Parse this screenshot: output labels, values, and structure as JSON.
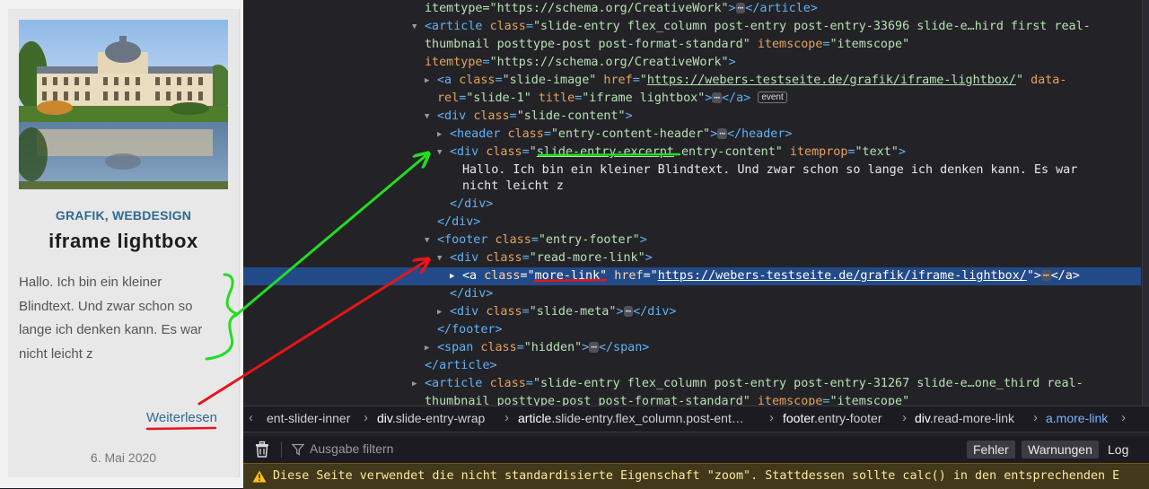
{
  "preview": {
    "categories": [
      "GRAFIK",
      "WEBDESIGN"
    ],
    "category_separator": ", ",
    "title": "iframe lightbox",
    "excerpt_lines": [
      "Hallo. Ich bin ein kleiner",
      "Blindtext. Und zwar schon so",
      "lange ich denken kann. Es war",
      "nicht leicht z"
    ],
    "more_link": "Weiterlesen",
    "date": "6. Mai 2020"
  },
  "dom_tree": {
    "rows": [
      {
        "parts": [
          [
            "av",
            "itemtype=\"https://schema.org/CreativeWork\""
          ],
          [
            "tg",
            ">"
          ],
          [
            "dots",
            "⋯"
          ],
          [
            "tg",
            "</article>"
          ]
        ]
      },
      {
        "twisty": "open",
        "parts": [
          [
            "tg",
            "<article "
          ],
          [
            "an",
            "class"
          ],
          [
            "tg",
            "="
          ],
          [
            "av",
            "\"slide-entry flex_column post-entry post-entry-33696 slide-e…hird first real-"
          ]
        ]
      },
      {
        "parts": [
          [
            "av",
            "thumbnail posttype-post post-format-standard\""
          ],
          [
            "an",
            " itemscope"
          ],
          [
            "tg",
            "="
          ],
          [
            "av",
            "\"itemscope\""
          ]
        ]
      },
      {
        "parts": [
          [
            "an",
            "itemtype"
          ],
          [
            "tg",
            "="
          ],
          [
            "av",
            "\"https://schema.org/CreativeWork\""
          ],
          [
            "tg",
            ">"
          ]
        ]
      },
      {
        "twisty": "closed",
        "parts": [
          [
            "tg",
            "<a "
          ],
          [
            "an",
            "class"
          ],
          [
            "tg",
            "="
          ],
          [
            "av",
            "\"slide-image\""
          ],
          [
            "an",
            " href"
          ],
          [
            "tg",
            "="
          ],
          [
            "av",
            "\""
          ],
          [
            "avu",
            "https://webers-testseite.de/grafik/iframe-lightbox/"
          ],
          [
            "av",
            "\""
          ],
          [
            "an",
            " data-"
          ]
        ]
      },
      {
        "parts": [
          [
            "an",
            "rel"
          ],
          [
            "tg",
            "="
          ],
          [
            "av",
            "\"slide-1\""
          ],
          [
            "an",
            " title"
          ],
          [
            "tg",
            "="
          ],
          [
            "av",
            "\"iframe lightbox\""
          ],
          [
            "tg",
            ">"
          ],
          [
            "dots",
            "⋯"
          ],
          [
            "tg",
            "</a> "
          ],
          [
            "evt",
            "event"
          ]
        ]
      },
      {
        "twisty": "open",
        "parts": [
          [
            "tg",
            "<div "
          ],
          [
            "an",
            "class"
          ],
          [
            "tg",
            "="
          ],
          [
            "av",
            "\"slide-content\""
          ],
          [
            "tg",
            ">"
          ]
        ]
      },
      {
        "twisty": "closed",
        "parts": [
          [
            "tg",
            "<header "
          ],
          [
            "an",
            "class"
          ],
          [
            "tg",
            "="
          ],
          [
            "av",
            "\"entry-content-header\""
          ],
          [
            "tg",
            ">"
          ],
          [
            "dots",
            "⋯"
          ],
          [
            "tg",
            "</header>"
          ]
        ]
      },
      {
        "twisty": "open",
        "parts": [
          [
            "tg",
            "<div "
          ],
          [
            "an",
            "class"
          ],
          [
            "tg",
            "="
          ],
          [
            "av",
            "\""
          ],
          [
            "avu",
            "slide-entry-excerpt"
          ],
          [
            "av",
            " entry-content\""
          ],
          [
            "an",
            " itemprop"
          ],
          [
            "tg",
            "="
          ],
          [
            "av",
            "\"text\""
          ],
          [
            "tg",
            ">"
          ]
        ]
      },
      {
        "parts": [
          [
            "txt",
            "Hallo. Ich bin ein kleiner Blindtext. Und zwar schon so lange ich denken kann. Es war"
          ]
        ]
      },
      {
        "parts": [
          [
            "txt",
            "nicht leicht z"
          ]
        ]
      },
      {
        "parts": [
          [
            "tg",
            "</div>"
          ]
        ]
      },
      {
        "parts": [
          [
            "tg",
            "</div>"
          ]
        ]
      },
      {
        "twisty": "open",
        "parts": [
          [
            "tg",
            "<footer "
          ],
          [
            "an",
            "class"
          ],
          [
            "tg",
            "="
          ],
          [
            "av",
            "\"entry-footer\""
          ],
          [
            "tg",
            ">"
          ]
        ]
      },
      {
        "twisty": "open",
        "parts": [
          [
            "tg",
            "<div "
          ],
          [
            "an",
            "class"
          ],
          [
            "tg",
            "="
          ],
          [
            "av",
            "\"read-more-link\""
          ],
          [
            "tg",
            ">"
          ]
        ]
      },
      {
        "twisty": "closed",
        "selected": true,
        "parts": [
          [
            "tg",
            "<a "
          ],
          [
            "an",
            "class"
          ],
          [
            "tg",
            "="
          ],
          [
            "av",
            "\"more-link\""
          ],
          [
            "an",
            " href"
          ],
          [
            "tg",
            "="
          ],
          [
            "av",
            "\""
          ],
          [
            "avu",
            "https://webers-testseite.de/grafik/iframe-lightbox/"
          ],
          [
            "av",
            "\""
          ],
          [
            "tg",
            ">"
          ],
          [
            "dots",
            "⋯"
          ],
          [
            "tg",
            "</a>"
          ]
        ]
      },
      {
        "parts": [
          [
            "tg",
            "</div>"
          ]
        ]
      },
      {
        "twisty": "closed",
        "parts": [
          [
            "tg",
            "<div "
          ],
          [
            "an",
            "class"
          ],
          [
            "tg",
            "="
          ],
          [
            "av",
            "\"slide-meta\""
          ],
          [
            "tg",
            ">"
          ],
          [
            "dots",
            "⋯"
          ],
          [
            "tg",
            "</div>"
          ]
        ]
      },
      {
        "parts": [
          [
            "tg",
            "</footer>"
          ]
        ]
      },
      {
        "twisty": "closed",
        "parts": [
          [
            "tg",
            "<span "
          ],
          [
            "an",
            "class"
          ],
          [
            "tg",
            "="
          ],
          [
            "av",
            "\"hidden\""
          ],
          [
            "tg",
            ">"
          ],
          [
            "dots",
            "⋯"
          ],
          [
            "tg",
            "</span>"
          ]
        ]
      },
      {
        "parts": [
          [
            "tg",
            "</article>"
          ]
        ]
      },
      {
        "twisty": "closed",
        "parts": [
          [
            "tg",
            "<article "
          ],
          [
            "an",
            "class"
          ],
          [
            "tg",
            "="
          ],
          [
            "av",
            "\"slide-entry flex_column post-entry post-entry-31267 slide-e…one_third real-"
          ]
        ]
      },
      {
        "parts": [
          [
            "av",
            "thumbnail posttype-post post-format-standard\""
          ],
          [
            "an",
            " itemscope"
          ],
          [
            "tg",
            "="
          ],
          [
            "av",
            "\"itemscope\""
          ]
        ]
      }
    ]
  },
  "breadcrumbs": [
    {
      "tag": "",
      "cls": "ent-slider-inner"
    },
    {
      "tag": "div",
      "cls": ".slide-entry-wrap"
    },
    {
      "tag": "article",
      "cls": ".slide-entry.flex_column.post-ent…"
    },
    {
      "tag": "footer",
      "cls": ".entry-footer"
    },
    {
      "tag": "div",
      "cls": ".read-more-link"
    },
    {
      "tag": "a",
      "cls": ".more-link"
    }
  ],
  "console": {
    "filter_placeholder": "Ausgabe filtern",
    "errors_button": "Fehler",
    "warnings_button": "Warnungen",
    "log_button": "Log",
    "warning_message": "Diese Seite verwendet die nicht standardisierte Eigenschaft \"zoom\". Stattdessen sollte calc() in den entsprechenden E"
  },
  "colors": {
    "annotation_green": "#22dd22",
    "annotation_red": "#e8141a",
    "selection_row": "#234a88",
    "link_blue": "#2f6a93"
  }
}
